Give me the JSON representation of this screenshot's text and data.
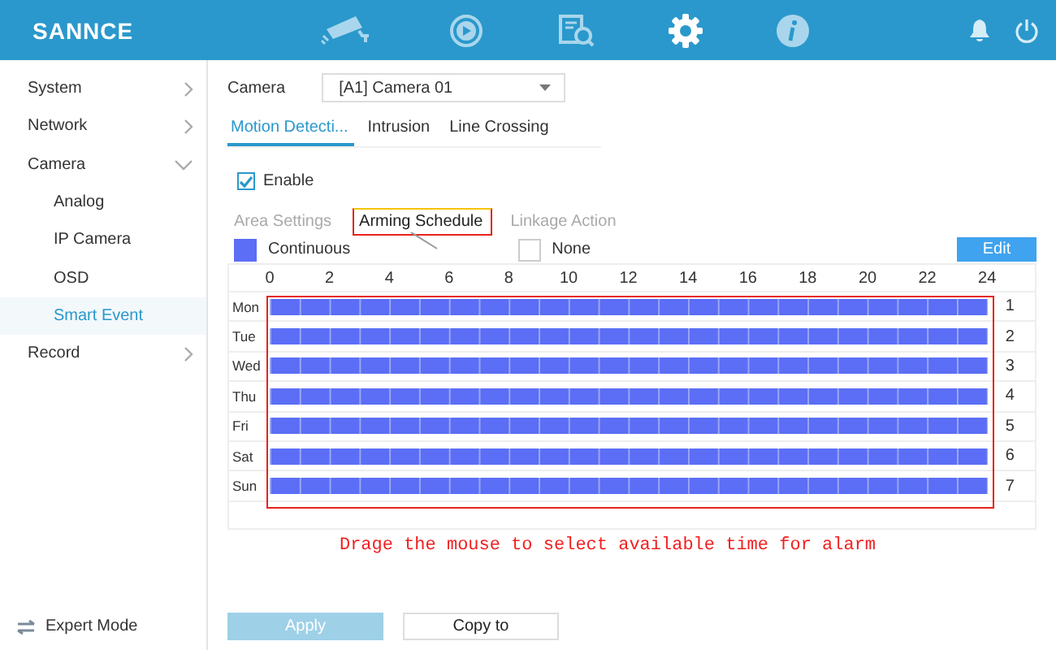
{
  "logo": "SANNCE",
  "nav": [
    {
      "kind": "camera",
      "selected": false
    },
    {
      "kind": "playback",
      "selected": false
    },
    {
      "kind": "search",
      "selected": false
    },
    {
      "kind": "settings",
      "selected": true
    },
    {
      "kind": "info",
      "selected": false
    }
  ],
  "sidebar": {
    "items": [
      {
        "label": "System",
        "expanded": false,
        "selected": false
      },
      {
        "label": "Network",
        "expanded": false,
        "selected": false
      },
      {
        "label": "Camera",
        "expanded": true,
        "selected": false,
        "children": [
          {
            "label": "Analog",
            "selected": false
          },
          {
            "label": "IP Camera",
            "selected": false
          },
          {
            "label": "OSD",
            "selected": false
          },
          {
            "label": "Smart Event",
            "selected": true
          }
        ]
      },
      {
        "label": "Record",
        "expanded": false,
        "selected": false
      }
    ],
    "footer": "Expert Mode"
  },
  "camera": {
    "label": "Camera",
    "value": "[A1] Camera 01"
  },
  "tabs": [
    {
      "label": "Motion Detecti...",
      "selected": true
    },
    {
      "label": "Intrusion",
      "selected": false
    },
    {
      "label": "Line Crossing",
      "selected": false
    }
  ],
  "enable": {
    "label": "Enable",
    "checked": true
  },
  "subtabs": [
    {
      "label": "Area Settings",
      "selected": false
    },
    {
      "label": "Arming Schedule",
      "selected": true
    },
    {
      "label": "Linkage Action",
      "selected": false
    }
  ],
  "legend": [
    {
      "label": "Continuous",
      "color": "#5b6ef5"
    },
    {
      "label": "None",
      "color": "#ffffff"
    }
  ],
  "edit_button": "Edit",
  "schedule": {
    "hours": [
      "0",
      "2",
      "4",
      "6",
      "8",
      "10",
      "12",
      "14",
      "16",
      "18",
      "20",
      "22",
      "24"
    ],
    "days": [
      {
        "label": "Mon",
        "number": "1",
        "filled": true
      },
      {
        "label": "Tue",
        "number": "2",
        "filled": true
      },
      {
        "label": "Wed",
        "number": "3",
        "filled": true
      },
      {
        "label": "Thu",
        "number": "4",
        "filled": true
      },
      {
        "label": "Fri",
        "number": "5",
        "filled": true
      },
      {
        "label": "Sat",
        "number": "6",
        "filled": true
      },
      {
        "label": "Sun",
        "number": "7",
        "filled": true
      }
    ]
  },
  "annotation": "Drage the mouse to select available time for alarm",
  "buttons": [
    {
      "label": "Apply",
      "disabled": true
    },
    {
      "label": "Copy to",
      "disabled": false
    }
  ]
}
